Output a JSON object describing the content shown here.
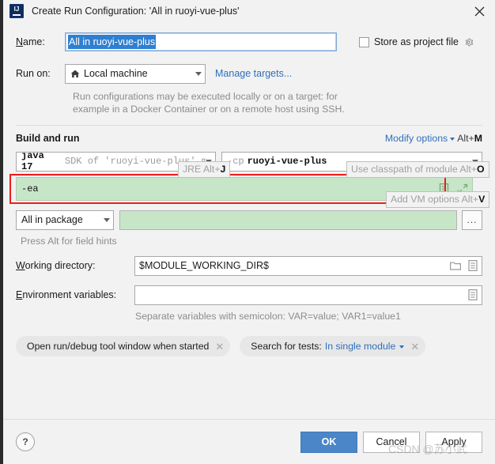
{
  "window": {
    "title": "Create Run Configuration: 'All in ruoyi-vue-plus'",
    "app_icon": "intellij-idea-icon",
    "close_icon": "close-icon"
  },
  "name_row": {
    "label": "Name:",
    "value": "All in ruoyi-vue-plus",
    "store_as_project_file_label": "Store as project file",
    "store_checked": false,
    "gear_icon": "gear-icon"
  },
  "run_on": {
    "label": "Run on:",
    "target": "Local machine",
    "target_icon": "home-icon",
    "manage_targets_link": "Manage targets...",
    "hint_line1": "Run configurations may be executed locally or on a target: for",
    "hint_line2": "example in a Docker Container or on a remote host using SSH."
  },
  "build_and_run": {
    "title": "Build and run",
    "modify_options_label": "Modify options",
    "modify_options_shortcut_prefix": "Alt+",
    "modify_options_shortcut_key": "M",
    "jre_bubble_text": "JRE Alt+",
    "jre_bubble_key": "J",
    "classpath_bubble_text": "Use classpath of module Alt+",
    "classpath_bubble_key": "O",
    "vm_bubble_text": "Add VM options Alt+",
    "vm_bubble_key": "V",
    "jre_name": "java 17",
    "jre_desc": "SDK of 'ruoyi-vue-plus' m",
    "classpath_flag": "-cp",
    "classpath_value": "ruoyi-vue-plus",
    "vm_options_value": "-ea",
    "vm_doc_icon": "document-icon",
    "vm_expand_icon": "expand-icon",
    "scope_combo": "All in package",
    "package_value": "",
    "browse_button": "...",
    "field_hints": "Press Alt for field hints"
  },
  "working_directory": {
    "label": "Working directory:",
    "value": "$MODULE_WORKING_DIR$",
    "folder_icon": "folder-icon",
    "macro_icon": "macro-list-icon"
  },
  "environment_variables": {
    "label": "Environment variables:",
    "value": "",
    "edit_icon": "macro-list-icon",
    "hint": "Separate variables with semicolon: VAR=value; VAR1=value1"
  },
  "chips": [
    {
      "label": "Open run/debug tool window when started",
      "value": "",
      "has_chevron": false,
      "close_icon": "close-icon"
    },
    {
      "label": "Search for tests:",
      "value": "In single module",
      "has_chevron": true,
      "close_icon": "close-icon"
    }
  ],
  "footer": {
    "help_label": "?",
    "ok_label": "OK",
    "cancel_label": "Cancel",
    "apply_label": "Apply"
  },
  "watermark": "CSDN @苏小武",
  "colors": {
    "dialog_bg": "#f2f2f2",
    "accent_blue": "#2e6fbc",
    "primary_button": "#4a86c8",
    "selection_blue": "#2f7fd0",
    "highlight_green": "#c7e6c7",
    "alert_red": "#ee1c1c"
  }
}
